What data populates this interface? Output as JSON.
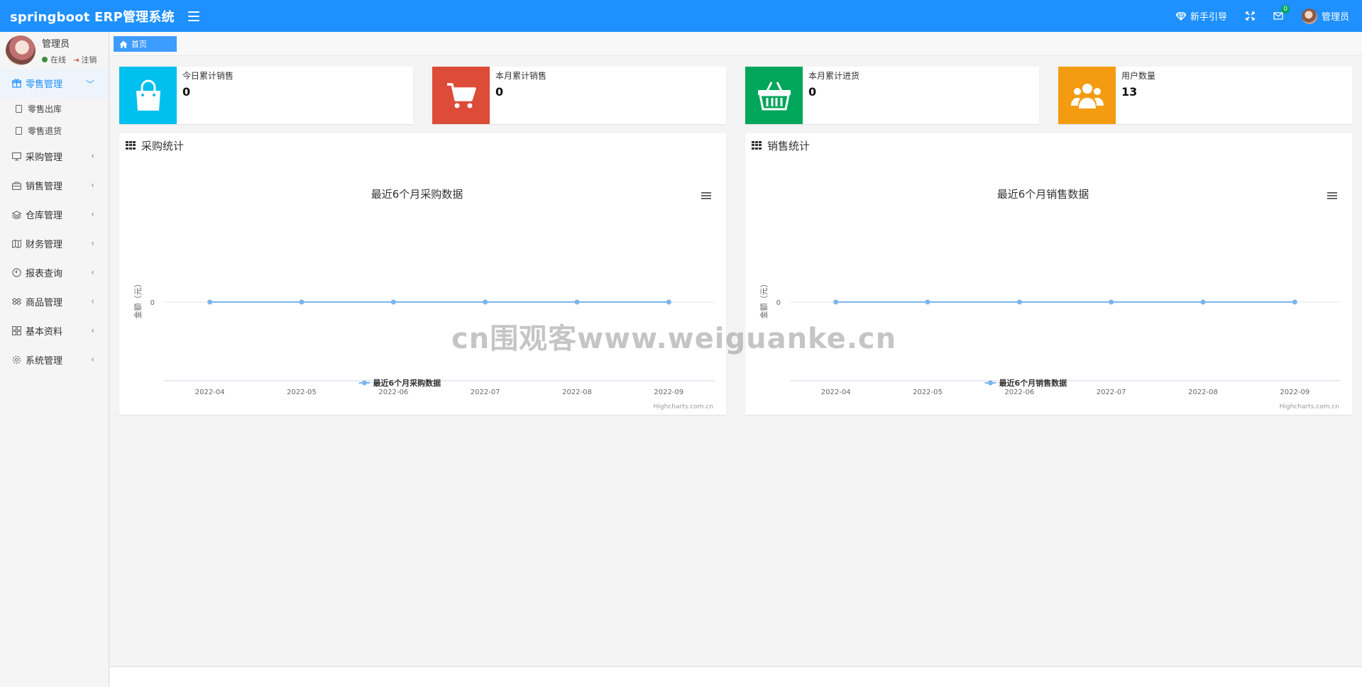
{
  "header": {
    "brand": "springboot ERP管理系统",
    "guide_label": "新手引导",
    "mail_count": "0",
    "user_name": "管理员"
  },
  "sidebar": {
    "user": {
      "name": "管理员",
      "status_online": "在线",
      "logout": "注销"
    },
    "menu": [
      {
        "label": "零售管理",
        "icon": "gift-icon",
        "expanded": true,
        "children": [
          {
            "label": "零售出库"
          },
          {
            "label": "零售退货"
          }
        ]
      },
      {
        "label": "采购管理",
        "icon": "monitor-icon"
      },
      {
        "label": "销售管理",
        "icon": "briefcase-icon"
      },
      {
        "label": "仓库管理",
        "icon": "layers-icon"
      },
      {
        "label": "财务管理",
        "icon": "map-icon"
      },
      {
        "label": "报表查询",
        "icon": "clock-icon"
      },
      {
        "label": "商品管理",
        "icon": "dropbox-icon"
      },
      {
        "label": "基本资料",
        "icon": "grid-icon"
      },
      {
        "label": "系统管理",
        "icon": "gear-icon"
      }
    ]
  },
  "breadcrumb": {
    "home": "首页"
  },
  "stats": [
    {
      "label": "今日累计销售",
      "value": "0",
      "color": "#00c0ef",
      "icon": "shopping-bag-icon"
    },
    {
      "label": "本月累计销售",
      "value": "0",
      "color": "#dd4b39",
      "icon": "cart-icon"
    },
    {
      "label": "本月累计进货",
      "value": "0",
      "color": "#00a65a",
      "icon": "basket-icon"
    },
    {
      "label": "用户数量",
      "value": "13",
      "color": "#f39c12",
      "icon": "users-icon"
    }
  ],
  "panels": [
    {
      "title": "采购统计"
    },
    {
      "title": "销售统计"
    }
  ],
  "credits": "Highcharts.com.cn",
  "watermark": "cn围观客www.weiguanke.cn",
  "chart_data": [
    {
      "type": "line",
      "title": "最近6个月采购数据",
      "ylabel": "金额（元）",
      "x": [
        "2022-04",
        "2022-05",
        "2022-06",
        "2022-07",
        "2022-08",
        "2022-09"
      ],
      "yticks": [
        "0"
      ],
      "series": [
        {
          "name": "最近6个月采购数据",
          "values": [
            0,
            0,
            0,
            0,
            0,
            0
          ]
        }
      ],
      "color": "#7cb5ec",
      "legend": "bottom-center"
    },
    {
      "type": "line",
      "title": "最近6个月销售数据",
      "ylabel": "金额（元）",
      "x": [
        "2022-04",
        "2022-05",
        "2022-06",
        "2022-07",
        "2022-08",
        "2022-09"
      ],
      "yticks": [
        "0"
      ],
      "series": [
        {
          "name": "最近6个月销售数据",
          "values": [
            0,
            0,
            0,
            0,
            0,
            0
          ]
        }
      ],
      "color": "#7cb5ec",
      "legend": "bottom-center"
    }
  ]
}
